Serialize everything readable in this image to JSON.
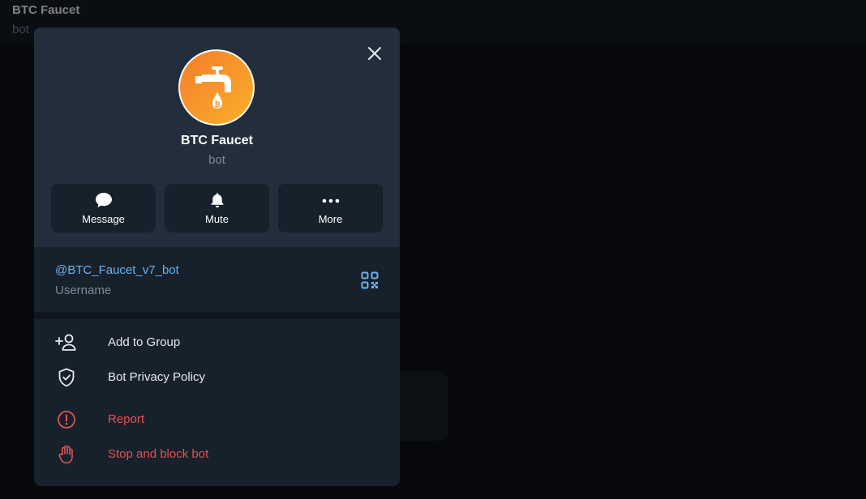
{
  "chat_header": {
    "title": "BTC Faucet",
    "subtitle": "bot"
  },
  "profile": {
    "name": "BTC Faucet",
    "status": "bot",
    "avatar_icon": "faucet-bitcoin-icon",
    "avatar_colors": [
      "#f57d2c",
      "#f9b02a"
    ]
  },
  "actions": [
    {
      "label": "Message",
      "icon": "chat-bubble-icon"
    },
    {
      "label": "Mute",
      "icon": "bell-icon"
    },
    {
      "label": "More",
      "icon": "more-dots-icon"
    }
  ],
  "info": {
    "username": "@BTC_Faucet_v7_bot",
    "username_caption": "Username",
    "qr_icon": "qr-code-icon"
  },
  "menu": [
    {
      "label": "Add to Group",
      "icon": "add-user-icon",
      "danger": false
    },
    {
      "label": "Bot Privacy Policy",
      "icon": "shield-check-icon",
      "danger": false
    },
    {
      "label": "Report",
      "icon": "alert-circle-icon",
      "danger": true
    },
    {
      "label": "Stop and block bot",
      "icon": "stop-hand-icon",
      "danger": true
    }
  ],
  "colors": {
    "accent": "#6ab2f2",
    "danger": "#e05353",
    "panel": "#17212b",
    "header": "#222e3b"
  }
}
